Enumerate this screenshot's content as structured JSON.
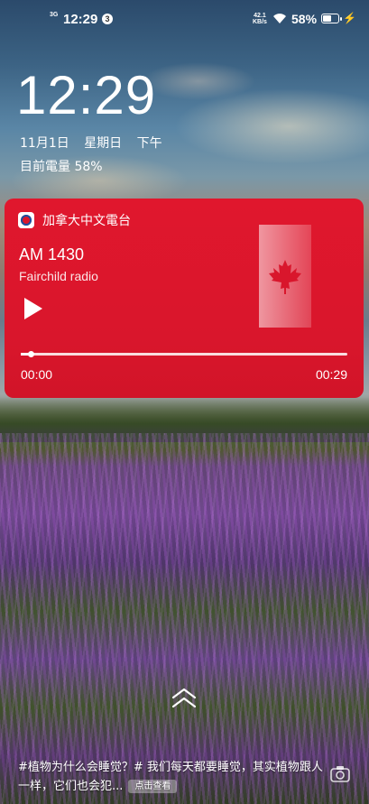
{
  "status_bar": {
    "network": "3G",
    "time": "12:29",
    "notification_count": "3",
    "speed_value": "42.1",
    "speed_unit": "KB/s",
    "battery_pct": "58%",
    "battery_level": 0.58,
    "icons": [
      "wifi-icon",
      "battery-icon",
      "charging-bolt-icon"
    ]
  },
  "lockscreen": {
    "clock": "12:29",
    "date": "11月1日",
    "weekday": "星期日",
    "ampm": "下午",
    "battery_text": "目前電量 58%"
  },
  "media_card": {
    "app_name": "加拿大中文電台",
    "title": "AM 1430",
    "subtitle": "Fairchild radio",
    "elapsed": "00:00",
    "duration": "00:29",
    "progress": 0.03,
    "colors": {
      "background": "#d9162c",
      "accent": "#ffffff"
    }
  },
  "news": {
    "text": "#植物为什么会睡觉？# 我们每天都要睡觉，其实植物跟人一样，它们也会犯...",
    "button": "点击查看"
  }
}
